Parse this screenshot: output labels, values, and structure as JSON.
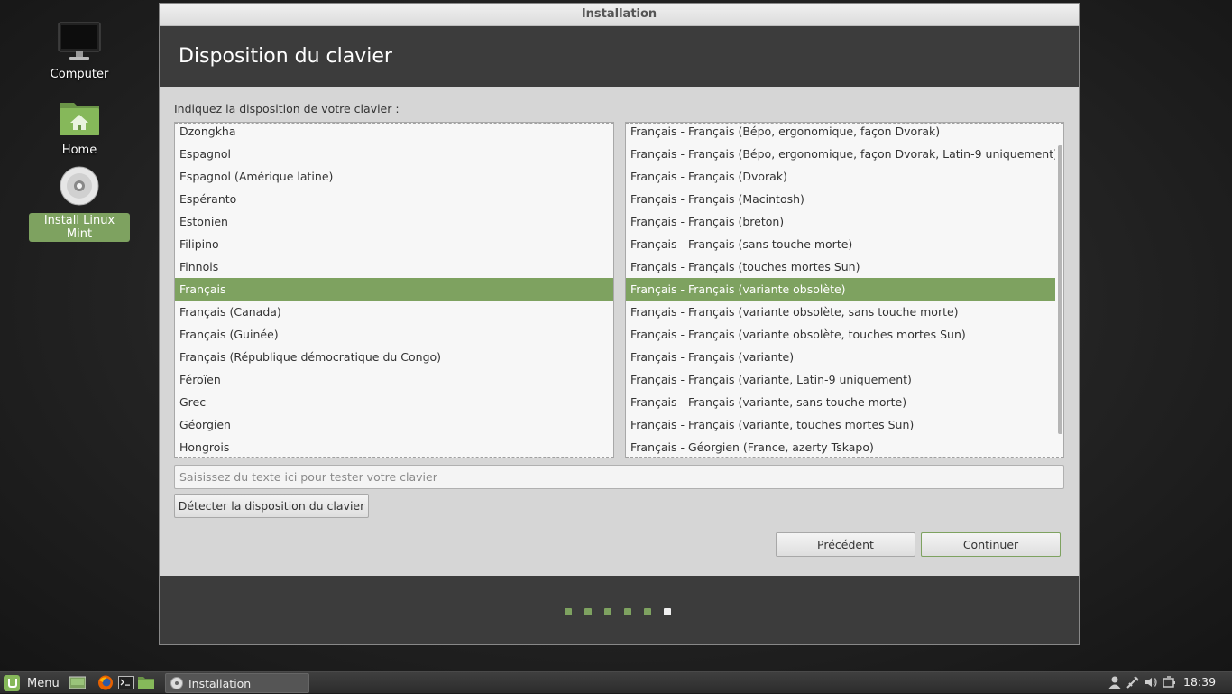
{
  "desktop": {
    "icons": [
      {
        "label": "Computer",
        "icon": "monitor-icon"
      },
      {
        "label": "Home",
        "icon": "home-folder-icon"
      },
      {
        "label": "Install Linux Mint",
        "icon": "disc-icon"
      }
    ]
  },
  "window": {
    "title": "Installation",
    "minimize_glyph": "–",
    "header_title": "Disposition du clavier",
    "prompt": "Indiquez la disposition de votre clavier :",
    "layouts": [
      "Dzongkha",
      "Espagnol",
      "Espagnol (Amérique latine)",
      "Espéranto",
      "Estonien",
      "Filipino",
      "Finnois",
      "Français",
      "Français (Canada)",
      "Français (Guinée)",
      "Français (République démocratique du Congo)",
      "Féroïen",
      "Grec",
      "Géorgien",
      "Hongrois"
    ],
    "selected_layout": "Français",
    "variants": [
      "Français - Français (Bépo, ergonomique, façon Dvorak)",
      "Français - Français (Bépo, ergonomique, façon Dvorak, Latin-9 uniquement)",
      "Français - Français (Dvorak)",
      "Français - Français (Macintosh)",
      "Français - Français (breton)",
      "Français - Français (sans touche morte)",
      "Français - Français (touches mortes Sun)",
      "Français - Français (variante obsolète)",
      "Français - Français (variante obsolète, sans touche morte)",
      "Français - Français (variante obsolète, touches mortes Sun)",
      "Français - Français (variante)",
      "Français - Français (variante, Latin-9 uniquement)",
      "Français - Français (variante, sans touche morte)",
      "Français - Français (variante, touches mortes Sun)",
      "Français - Géorgien (France, azerty Tskapo)"
    ],
    "selected_variant": "Français - Français (variante obsolète)",
    "test_placeholder": "Saisissez du texte ici pour tester votre clavier",
    "detect_label": "Détecter la disposition du clavier",
    "prev_label": "Précédent",
    "next_label": "Continuer",
    "progress": {
      "total_steps": 6,
      "current_step": 6
    }
  },
  "taskbar": {
    "menu_label": "Menu",
    "launchers": [
      "show-desktop-icon",
      "firefox-icon",
      "terminal-icon",
      "files-icon"
    ],
    "task_label": "Installation",
    "tray": [
      "user-icon",
      "network-icon",
      "volume-icon",
      "battery-icon"
    ],
    "clock": "18:39"
  },
  "colors": {
    "accent": "#7ea260",
    "header_bg": "#3c3c3c",
    "window_bg": "#d6d6d6"
  }
}
